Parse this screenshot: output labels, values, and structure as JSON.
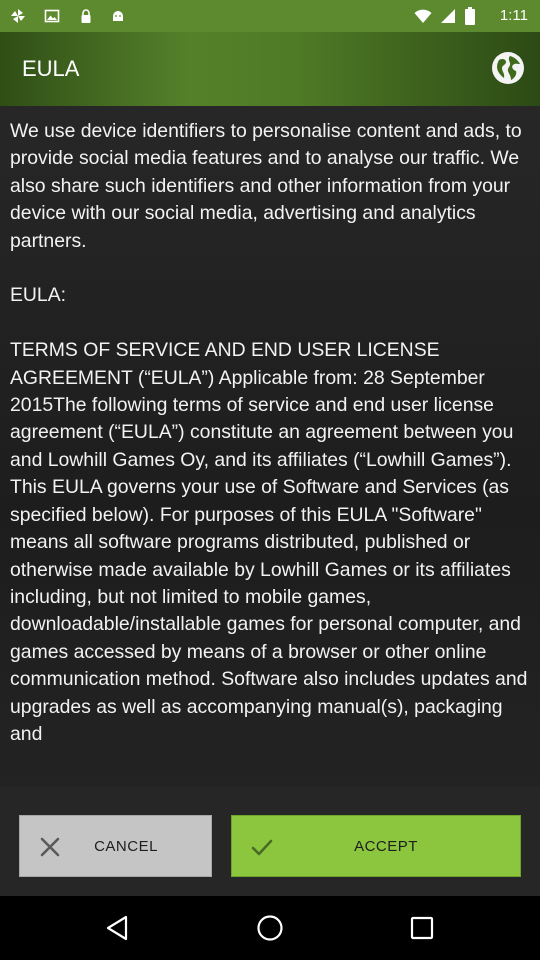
{
  "status_bar": {
    "time": "1:11",
    "left_icons": [
      "pinwheel-icon",
      "image-icon",
      "lock-icon",
      "android-icon"
    ],
    "right_icons": [
      "wifi-icon",
      "cellular-icon",
      "battery-icon"
    ]
  },
  "app_bar": {
    "title": "EULA",
    "action_icon": "globe-icon"
  },
  "content": {
    "eula_text": "We use device identifiers to personalise content and ads, to provide social media features and to analyse our traffic. We also share such identifiers and other information from your device with our social media, advertising and analytics partners.\n\nEULA:\n\nTERMS OF SERVICE AND END USER LICENSE AGREEMENT (“EULA”) Applicable from: 28 September 2015The following terms of service and end user license agreement (“EULA”) constitute an agreement between you and Lowhill Games Oy, and its affiliates (“Lowhill Games”). This EULA governs your use of Software and Services (as specified below). For purposes of this EULA \"Software\" means all software programs distributed, published or otherwise made available by Lowhill Games or its affiliates including, but not limited to mobile games, downloadable/installable games for personal computer, and games accessed by means of a browser or other online communication method. Software also includes updates and upgrades as well as accompanying manual(s), packaging and"
  },
  "buttons": {
    "cancel_label": "CANCEL",
    "accept_label": "ACCEPT",
    "cancel_icon": "close-icon",
    "accept_icon": "check-icon"
  },
  "nav_bar": {
    "icons": [
      "back-icon",
      "home-icon",
      "recents-icon"
    ]
  },
  "colors": {
    "status_bar": "#5d8a2e",
    "app_bar": "#4f7a26",
    "accept_button": "#8cc63f",
    "cancel_button": "#c5c5c5"
  }
}
